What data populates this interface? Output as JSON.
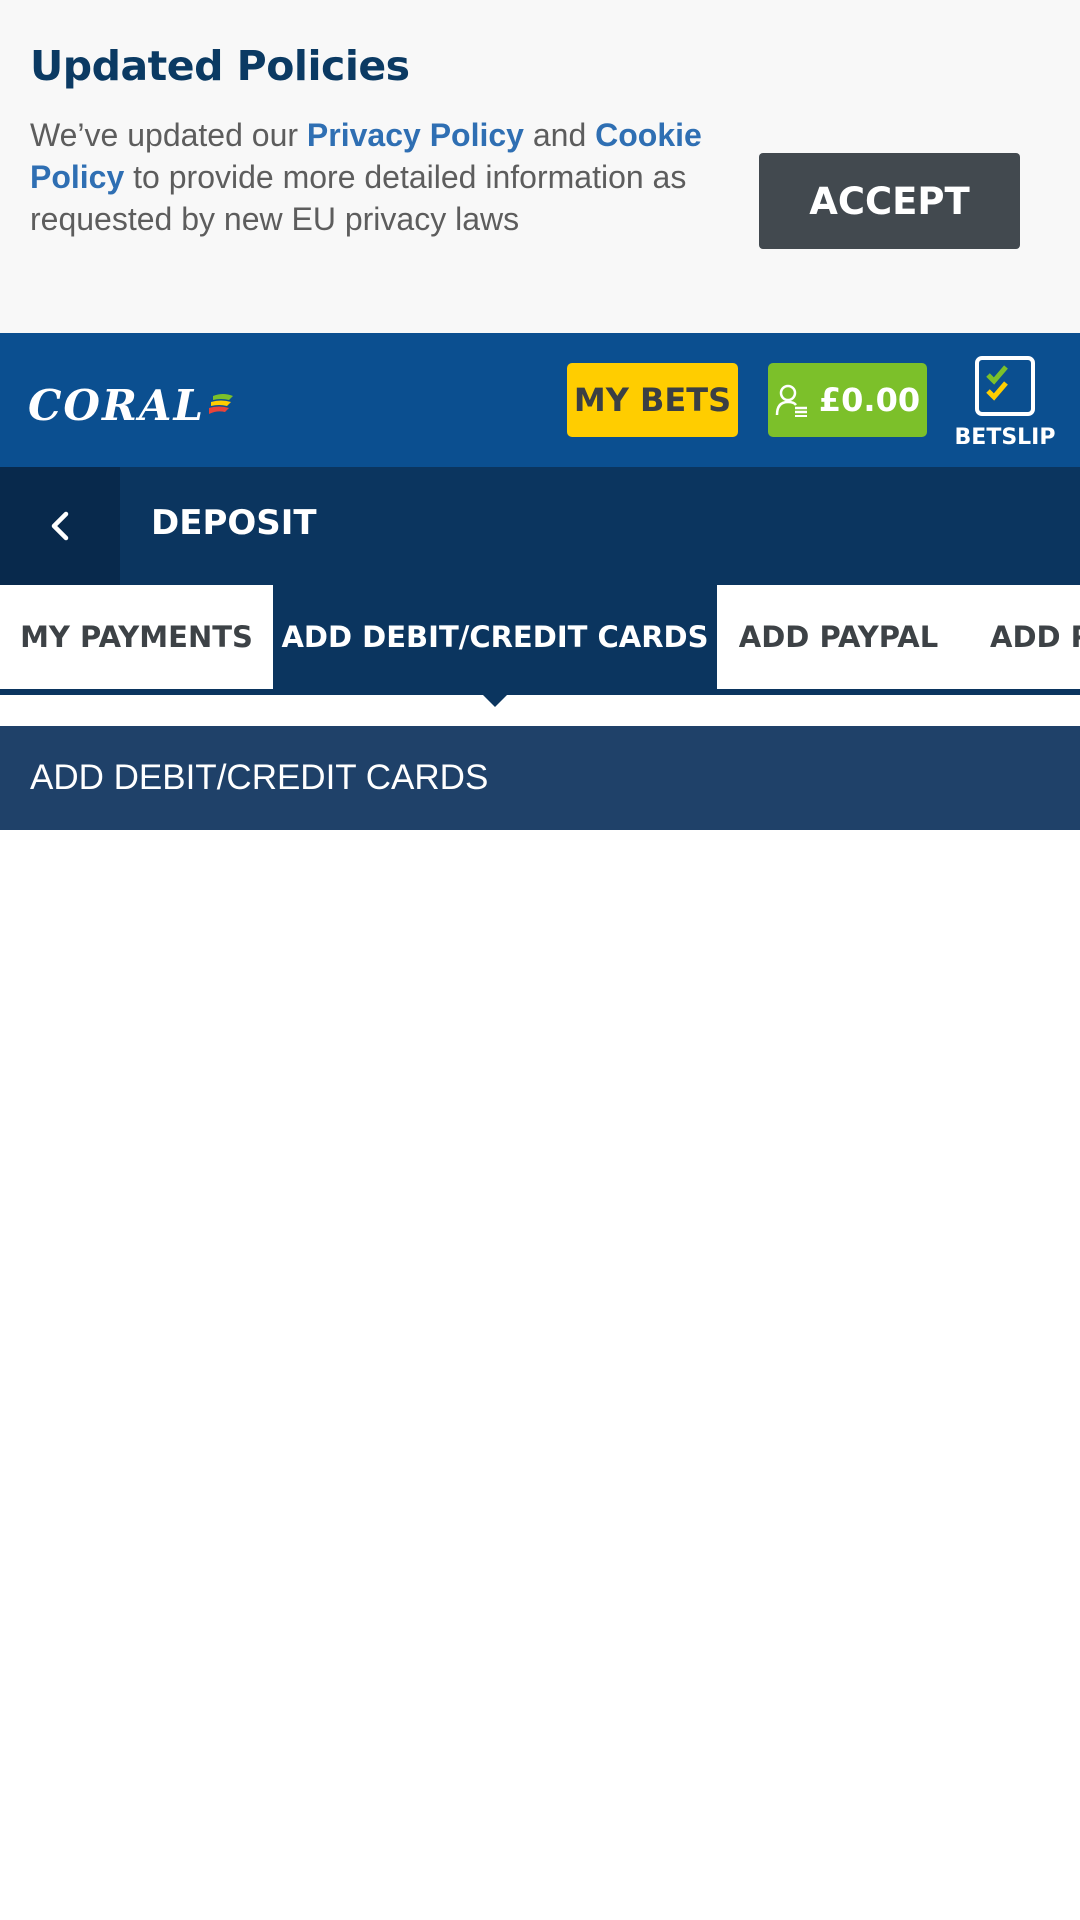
{
  "policy_banner": {
    "title": "Updated Policies",
    "text_before": "We’ve updated our ",
    "privacy_link": "Privacy Policy",
    "text_and": " and ",
    "cookie_link": "Cookie Policy",
    "text_after": " to provide more detailed information as requested by new EU privacy laws",
    "accept_label": "ACCEPT"
  },
  "header": {
    "logo_text": "CORAL",
    "my_bets_label": "MY BETS",
    "balance": "£0.00",
    "betslip_label": "BETSLIP",
    "colors": {
      "header_bg": "#0b4f90",
      "my_bets_bg": "#ffcd00",
      "balance_bg": "#7cc02a"
    }
  },
  "titlebar": {
    "back_icon": "chevron-left-icon",
    "title": "DEPOSIT"
  },
  "tabs": [
    {
      "label": "MY PAYMENTS",
      "active": false
    },
    {
      "label": "ADD DEBIT/CREDIT CARDS",
      "active": true
    },
    {
      "label": "ADD PAYPAL",
      "active": false
    },
    {
      "label": "ADD P",
      "active": false
    }
  ],
  "section": {
    "title": "ADD DEBIT/CREDIT CARDS"
  }
}
